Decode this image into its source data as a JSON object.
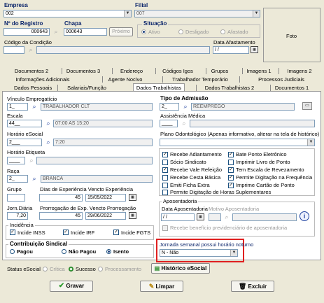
{
  "header": {
    "empresa_label": "Empresa",
    "empresa_value": "002",
    "filial_label": "Filial",
    "filial_value": "007",
    "registro_label": "Nº do Registro",
    "registro_value": "000643",
    "chapa_label": "Chapa",
    "chapa_value": "000643",
    "proximo_label": "Próximo",
    "situacao_label": "Situação",
    "situacao_options": [
      "Ativo",
      "Desligado",
      "Afastado"
    ],
    "condicao_label": "Código da Condição",
    "condicao_value": "",
    "data_afastamento_label": "Data Afastamento",
    "data_afastamento_value": "/ /",
    "foto_label": "Foto"
  },
  "tabs": {
    "row1": [
      "Documentos 2",
      "Documentos 3",
      "Endereço",
      "Códigos Igos",
      "Grupos",
      "Imagens 1",
      "Imagens 2"
    ],
    "row2": [
      "Informações Adicionais",
      "Agente Nocivo",
      "Trabalhador Temporário",
      "Processos Judiciais"
    ],
    "row3": [
      "Dados Pessoais",
      "Salariais/Função",
      "Dados Trabalhistas",
      "Dados Trabalhistas 2",
      "Documentos 1"
    ]
  },
  "left": {
    "vinculo_label": "Vínculo Empregatício",
    "vinculo_code": "1_",
    "vinculo_desc": "TRABALHADOR CLT",
    "escala_label": "Escala",
    "escala_code": "44__",
    "escala_desc": "07:00 AS 15:20",
    "horario_esocial_label": "Horário eSocial",
    "horario_esocial_code": "2___",
    "horario_esocial_desc": "7:20",
    "horario_etiqueta_label": "Horário Etiqueta",
    "horario_etiqueta_code": "____",
    "raca_label": "Raça",
    "raca_code": "2_",
    "raca_desc": "BRANCA",
    "grupo_label": "Grupo",
    "grupo_value": "",
    "dias_exp_label": "Dias de Experiência Vencto Experiência",
    "dias_exp_value": "45",
    "vencto_exp_value": "15/05/2022",
    "jorn_diaria_label": "Jorn.Diária",
    "jorn_diaria_value": "7,20",
    "prorrogacao_label": "Prorrogação de Exp. Vencto Prorrogação",
    "prorrogacao_value": "45",
    "vencto_prorrog_value": "29/06/2022",
    "incidencia_label": "Incidência",
    "incidencia_items": [
      "Incide INSS",
      "Incide IRF",
      "Incide FGTS"
    ],
    "contribuicao_label": "Contribuição Sindical",
    "contribuicao_options": [
      "Pagou",
      "Não Pagou",
      "Isento"
    ]
  },
  "right": {
    "tipo_admissao_label": "Tipo de Admissão",
    "tipo_admissao_code": "2_",
    "tipo_admissao_desc": "REEMPREGO",
    "assistencia_label": "Assistência Médica",
    "assistencia_code": "____",
    "plano_label": "Plano Odontológico (Apenas informativo, alterar na tela de histórico)",
    "plano_value": "",
    "checks_left": [
      "Recebe Adiantamento",
      "Sócio Sindicato",
      "Recebe Vale Refeição",
      "Recebe Cesta Básica",
      "Emiti Ficha Extra",
      "Permite Digitação de Horas Suplementares"
    ],
    "checks_right": [
      "Bate Ponto Eletrônico",
      "Imprimir Livro de Ponto",
      "Tem Escala de Revezamento",
      "Permite Digitação na Frequência",
      "Imprime Cartão de Ponto"
    ],
    "aposentadoria_label": "Aposentadoria",
    "data_aposentadoria_label": "Data Aposentadoria",
    "motivo_aposentadoria_label": "Motivo Aposentadoria",
    "data_aposentadoria_value": "/ /",
    "beneficio_label": "Recebe benefício previdenciário de aposentadoria",
    "jornada_label": "Jornada semanal possui horário noturno",
    "jornada_value": "N - Não"
  },
  "status": {
    "label": "Status eSocial",
    "options": [
      "Crítica",
      "Sucesso",
      "Processamento"
    ],
    "historico_label": "Histórico eSocial"
  },
  "actions": {
    "gravar": "Gravar",
    "limpar": "Limpar",
    "excluir": "Excluir"
  },
  "colors": {
    "highlight": "#e02020",
    "label_blue": "#0a246a",
    "success": "#37a33a"
  }
}
